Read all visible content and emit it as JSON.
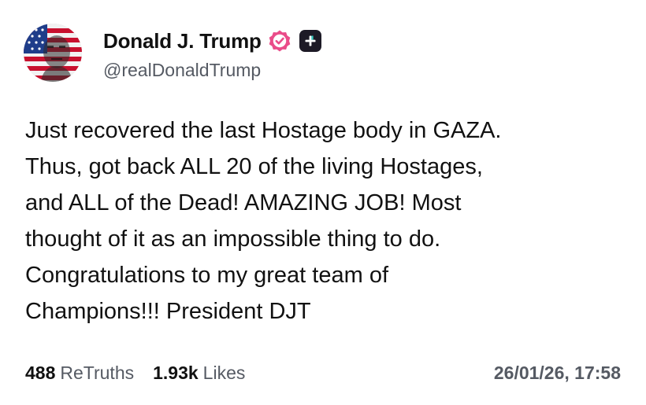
{
  "author": {
    "display_name": "Donald J. Trump",
    "handle": "@realDonaldTrump",
    "avatar_icon": "flag-portrait-avatar",
    "verified_icon": "verified-badge-icon",
    "verified_color": "#ea4c89",
    "plus_icon": "plus-icon"
  },
  "post": {
    "text": "Just recovered the last Hostage body in GAZA.\nThus, got back ALL 20 of the living Hostages,\nand ALL of the Dead! AMAZING JOB! Most\nthought of it as an impossible thing to do.\nCongratulations to my great team of\nChampions!!! President DJT"
  },
  "stats": {
    "retruths_count": "488",
    "retruths_label": "ReTruths",
    "likes_count": "1.93k",
    "likes_label": "Likes",
    "timestamp": "26/01/26, 17:58"
  }
}
